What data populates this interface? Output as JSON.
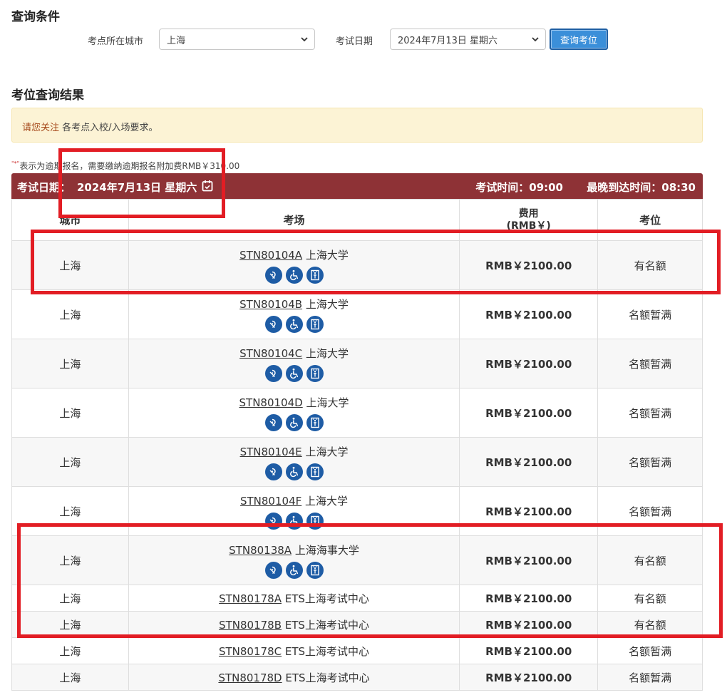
{
  "query": {
    "title": "查询条件",
    "city_label": "考点所在城市",
    "city_value": "上海",
    "date_label": "考试日期",
    "date_value": "2024年7月13日 星期六",
    "button_label": "查询考位"
  },
  "results": {
    "title": "考位查询结果",
    "notice_highlight": "请您关注",
    "notice_text": " 各考点入校/入场要求。",
    "late_star": "\"*\"",
    "late_note": "表示为逾期报名，需要缴纳逾期报名附加费RMB￥310.00",
    "header": {
      "date_label": "考试日期：",
      "date_value": "2024年7月13日 星期六",
      "exam_time": "考试时间：09:00",
      "latest_arrival": "最晚到达时间：08:30"
    },
    "columns": {
      "city": "城市",
      "venue": "考场",
      "fee_line1": "费用",
      "fee_line2": "(RMB￥)",
      "seat": "考位"
    },
    "rows": [
      {
        "city": "上海",
        "code": "STN80104A",
        "venue": "上海大学",
        "fee": "RMB￥2100.00",
        "seat": "有名额",
        "icons": true
      },
      {
        "city": "上海",
        "code": "STN80104B",
        "venue": "上海大学",
        "fee": "RMB￥2100.00",
        "seat": "名额暂满",
        "icons": true
      },
      {
        "city": "上海",
        "code": "STN80104C",
        "venue": "上海大学",
        "fee": "RMB￥2100.00",
        "seat": "名额暂满",
        "icons": true
      },
      {
        "city": "上海",
        "code": "STN80104D",
        "venue": "上海大学",
        "fee": "RMB￥2100.00",
        "seat": "名额暂满",
        "icons": true
      },
      {
        "city": "上海",
        "code": "STN80104E",
        "venue": "上海大学",
        "fee": "RMB￥2100.00",
        "seat": "名额暂满",
        "icons": true
      },
      {
        "city": "上海",
        "code": "STN80104F",
        "venue": "上海大学",
        "fee": "RMB￥2100.00",
        "seat": "名额暂满",
        "icons": true
      },
      {
        "city": "上海",
        "code": "STN80138A",
        "venue": "上海海事大学",
        "fee": "RMB￥2100.00",
        "seat": "有名额",
        "icons": true
      },
      {
        "city": "上海",
        "code": "STN80178A",
        "venue": "ETS上海考试中心",
        "fee": "RMB￥2100.00",
        "seat": "有名额",
        "icons": false
      },
      {
        "city": "上海",
        "code": "STN80178B",
        "venue": "ETS上海考试中心",
        "fee": "RMB￥2100.00",
        "seat": "有名额",
        "icons": false
      },
      {
        "city": "上海",
        "code": "STN80178C",
        "venue": "ETS上海考试中心",
        "fee": "RMB￥2100.00",
        "seat": "名额暂满",
        "icons": false
      },
      {
        "city": "上海",
        "code": "STN80178D",
        "venue": "ETS上海考试中心",
        "fee": "RMB￥2100.00",
        "seat": "名额暂满",
        "icons": false
      }
    ],
    "icon_names": [
      "hearing-accessibility-icon",
      "wheelchair-accessibility-icon",
      "elevator-icon"
    ]
  },
  "colors": {
    "header_bar": "#8e3236",
    "accent_button": "#3b8fd9",
    "notice_bg": "#fcf3d5",
    "icon_blue": "#1e5ca5",
    "annotation_red": "#e21d24"
  }
}
